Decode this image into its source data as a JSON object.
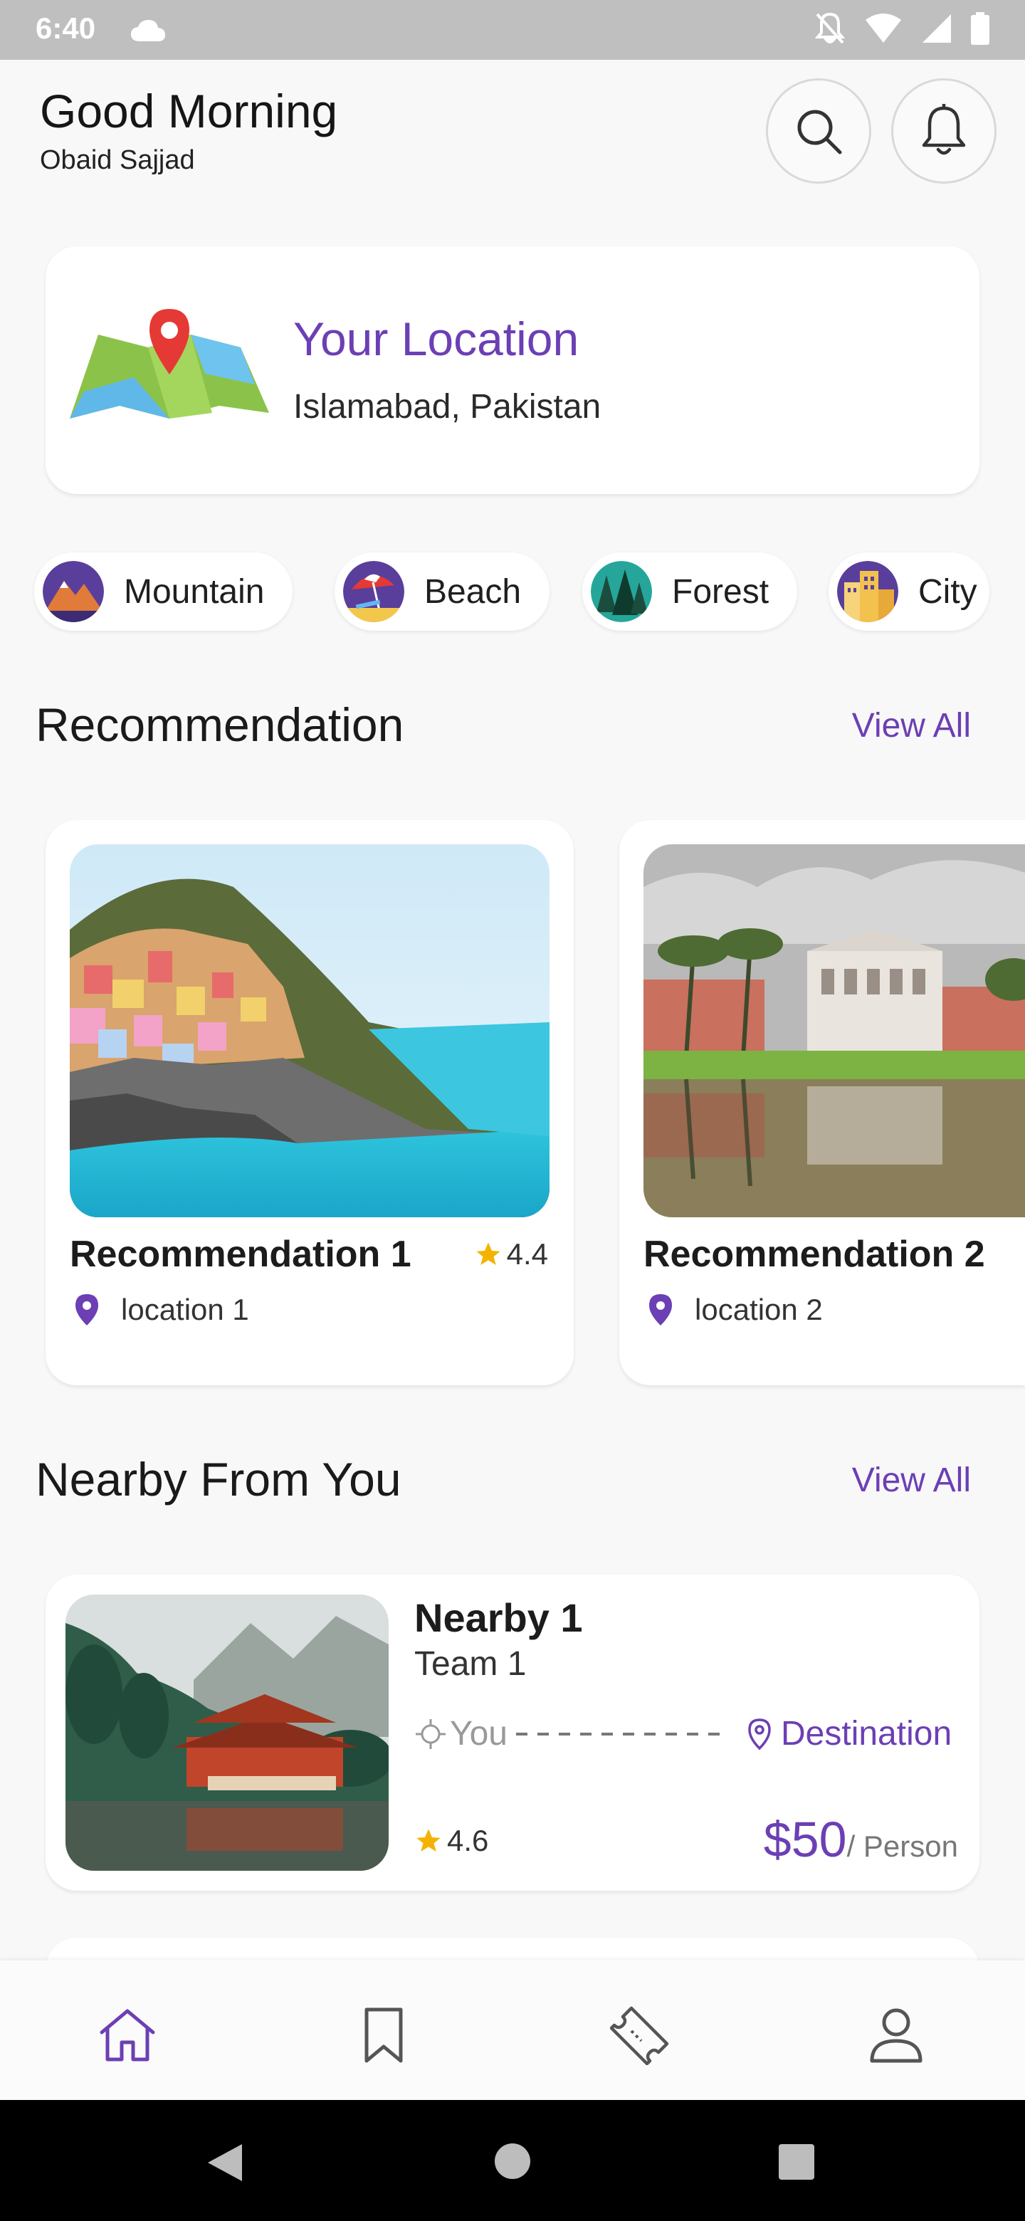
{
  "status_bar": {
    "time": "6:40",
    "icons": [
      "cloud-icon",
      "notifications-off-icon",
      "wifi-icon",
      "signal-icon",
      "battery-icon"
    ]
  },
  "header": {
    "greeting": "Good Morning",
    "user_name": "Obaid Sajjad",
    "icons": [
      "search-icon",
      "bell-icon"
    ]
  },
  "location_card": {
    "title": "Your Location",
    "value": "Islamabad, Pakistan",
    "icon": "map-pin-icon"
  },
  "categories": [
    {
      "label": "Mountain",
      "icon": "mountain-icon"
    },
    {
      "label": "Beach",
      "icon": "beach-icon"
    },
    {
      "label": "Forest",
      "icon": "forest-icon"
    },
    {
      "label": "City",
      "icon": "city-icon"
    }
  ],
  "recommendation": {
    "title": "Recommendation",
    "view_all": "View All",
    "items": [
      {
        "title": "Recommendation 1",
        "rating": "4.4",
        "location": "location 1"
      },
      {
        "title": "Recommendation 2",
        "rating": "",
        "location": "location 2"
      }
    ]
  },
  "nearby": {
    "title": "Nearby From You",
    "view_all": "View All",
    "items": [
      {
        "title": "Nearby 1",
        "team": "Team 1",
        "from": "You",
        "to": "Destination",
        "rating": "4.6",
        "price": "$50",
        "unit": "/ Person"
      }
    ]
  },
  "bottom_nav": {
    "items": [
      "home-icon",
      "bookmark-icon",
      "ticket-icon",
      "profile-icon"
    ],
    "active": "home-icon"
  },
  "colors": {
    "accent": "#6c3fb4",
    "star": "#f5b301",
    "background": "#f8f8f8"
  }
}
